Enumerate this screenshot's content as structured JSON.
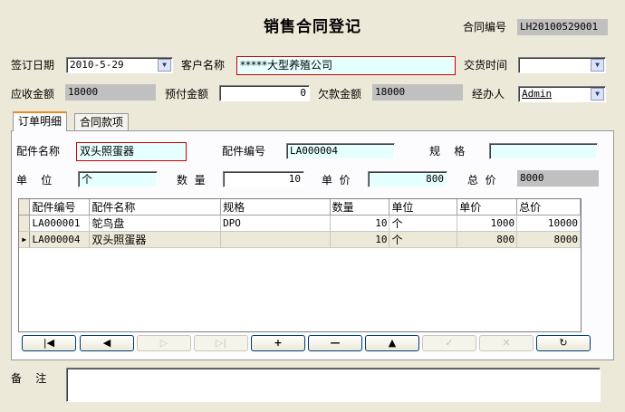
{
  "title": "销售合同登记",
  "contract_no": {
    "label": "合同编号",
    "value": "LH20100529001"
  },
  "sign_date": {
    "label": "签订日期",
    "value": "2010-5-29"
  },
  "customer": {
    "label": "客户名称",
    "value": "*****大型养殖公司"
  },
  "delivery_time": {
    "label": "交货时间",
    "value": ""
  },
  "receivable": {
    "label": "应收金额",
    "value": "18000"
  },
  "prepaid": {
    "label": "预付金额",
    "value": "0"
  },
  "arrears": {
    "label": "欠款金额",
    "value": "18000"
  },
  "handler": {
    "label": "经办人",
    "value": "Admin"
  },
  "tabs": [
    {
      "label": "订单明细"
    },
    {
      "label": "合同款项"
    }
  ],
  "detail": {
    "part_name": {
      "label": "配件名称",
      "value": "双头照蛋器"
    },
    "part_no": {
      "label": "配件编号",
      "value": "LA000004"
    },
    "spec": {
      "label": "规    格",
      "value": ""
    },
    "unit": {
      "label": "单    位",
      "value": "个"
    },
    "quantity": {
      "label": "数  量",
      "value": "10"
    },
    "unit_price": {
      "label": "单  价",
      "value": "800"
    },
    "total": {
      "label": "总  价",
      "value": "8000"
    }
  },
  "grid": {
    "columns": [
      "配件编号",
      "配件名称",
      "规格",
      "数量",
      "单位",
      "单价",
      "总价"
    ],
    "rows": [
      [
        "LA000001",
        "鸵鸟盘",
        "DPO",
        "10",
        "个",
        "1000",
        "10000"
      ],
      [
        "LA000004",
        "双头照蛋器",
        "",
        "10",
        "个",
        "800",
        "8000"
      ]
    ]
  },
  "nav_icons": [
    "first-icon",
    "prev-icon",
    "next-icon",
    "last-icon",
    "add-icon",
    "delete-icon",
    "edit-icon",
    "save-icon",
    "cancel-icon",
    "refresh-icon"
  ],
  "nav_glyphs": {
    "first": "|◀",
    "prev": "◀",
    "next": "▷",
    "last": "▷|",
    "add": "+",
    "delete": "—",
    "edit": "▲",
    "save": "✓",
    "cancel": "✕",
    "refresh": "↻"
  },
  "remark": {
    "label": "备    注",
    "value": ""
  }
}
